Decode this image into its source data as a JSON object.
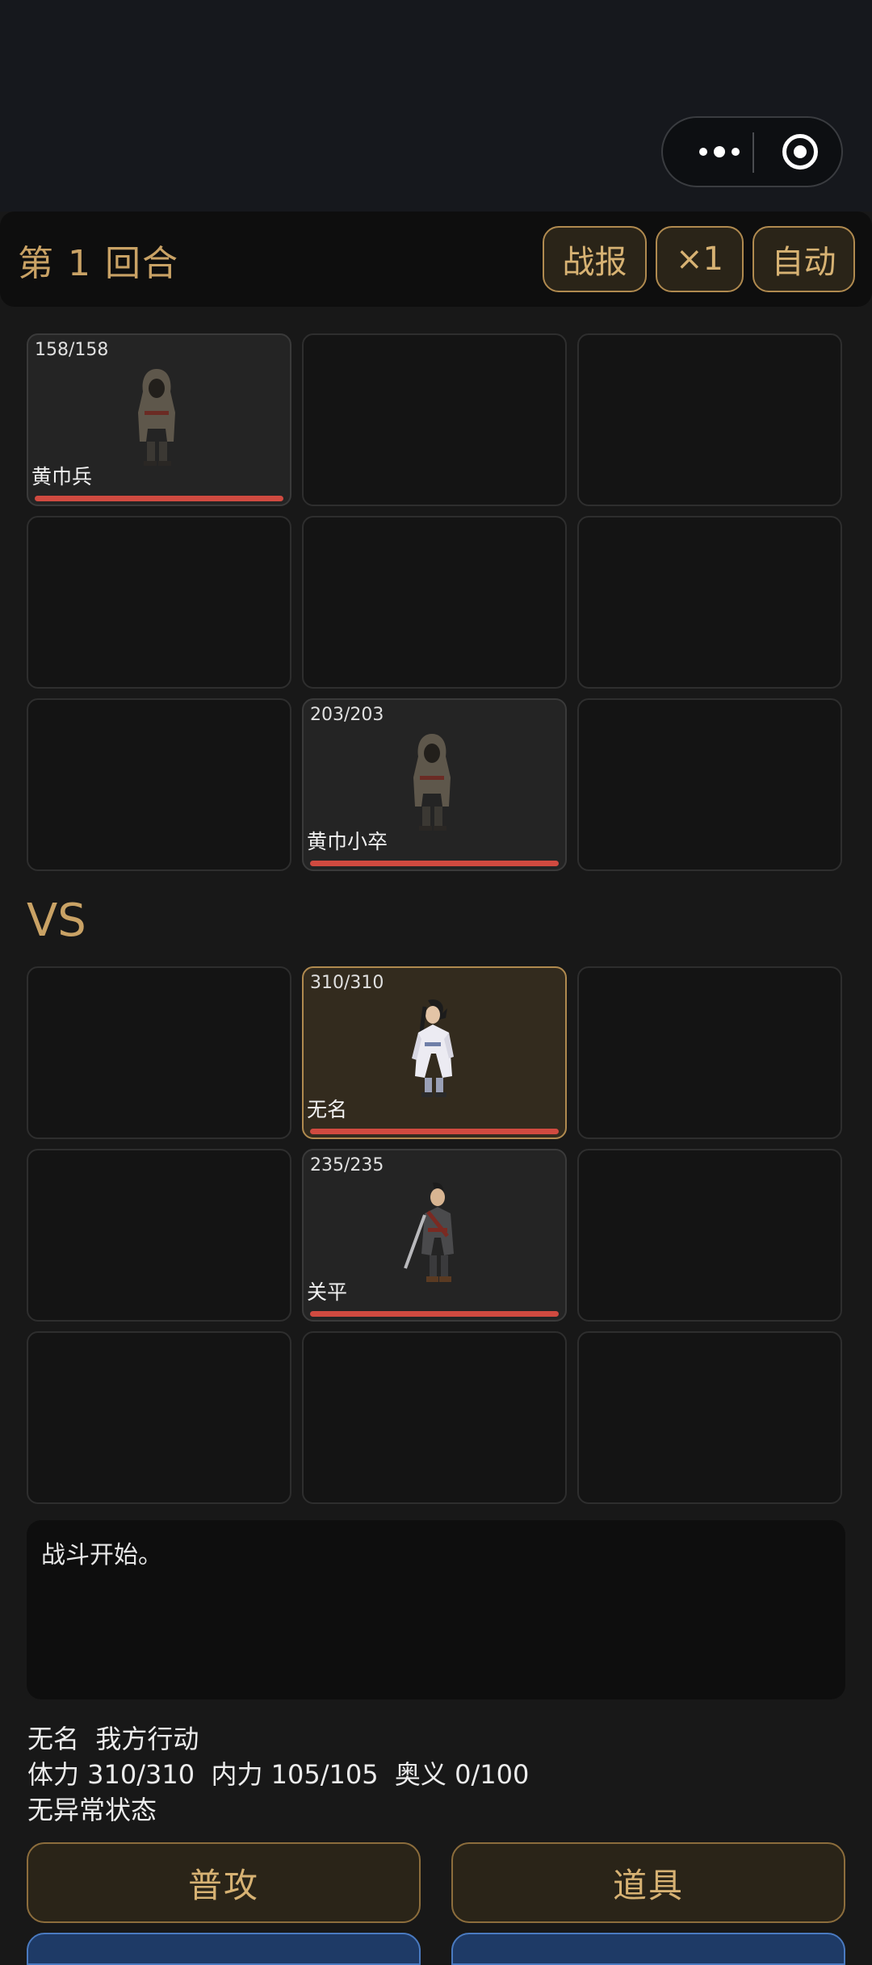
{
  "round": {
    "title": "第 1 回合"
  },
  "toolbar": {
    "report_label": "战报",
    "speed_label": "×1",
    "auto_label": "自动"
  },
  "enemy_grid": [
    {
      "hp": "158/158",
      "name": "黄巾兵"
    },
    null,
    null,
    null,
    null,
    null,
    null,
    {
      "hp": "203/203",
      "name": "黄巾小卒"
    },
    null
  ],
  "vs_label": "VS",
  "ally_grid": [
    null,
    {
      "hp": "310/310",
      "name": "无名"
    },
    null,
    null,
    {
      "hp": "235/235",
      "name": "关平"
    },
    null,
    null,
    null,
    null
  ],
  "battle_log": {
    "text": "战斗开始。"
  },
  "status_panel": {
    "line1": "无名  我方行动",
    "line2": "体力 310/310  内力 105/105  奥义 0/100",
    "line3": "无异常状态"
  },
  "actions": {
    "attack_label": "普攻",
    "item_label": "道具"
  },
  "colors": {
    "accent": "#c9a265",
    "hp_bar": "#d04a40",
    "selected_cell": "#332b1e"
  }
}
